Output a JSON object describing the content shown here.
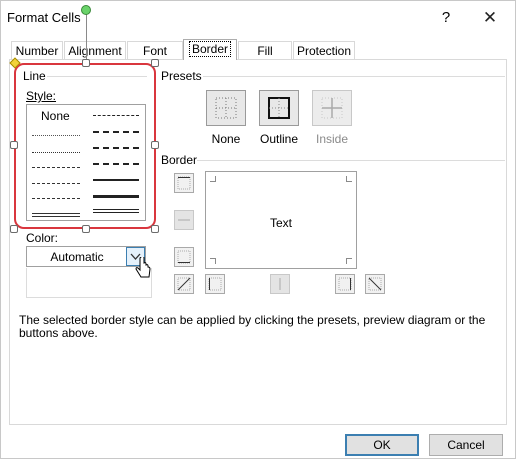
{
  "window": {
    "title": "Format Cells",
    "help": "?",
    "close": "✕"
  },
  "tabs": [
    {
      "label": "Number"
    },
    {
      "label": "Alignment"
    },
    {
      "label": "Font"
    },
    {
      "label": "Border",
      "active": true
    },
    {
      "label": "Fill"
    },
    {
      "label": "Protection"
    }
  ],
  "line_group": {
    "label": "Line",
    "style_label": "Style:",
    "none_option": "None",
    "color_label": "Color:",
    "color_value": "Automatic"
  },
  "presets_group": {
    "label": "Presets",
    "buttons": [
      "None",
      "Outline",
      "Inside"
    ]
  },
  "border_group": {
    "label": "Border",
    "preview_text": "Text"
  },
  "description": "The selected border style can be applied by clicking the presets, preview diagram or the buttons above.",
  "footer": {
    "ok": "OK",
    "cancel": "Cancel"
  },
  "colors": {
    "highlight_frame": "#d9363e",
    "accent": "#3c7fb1"
  }
}
